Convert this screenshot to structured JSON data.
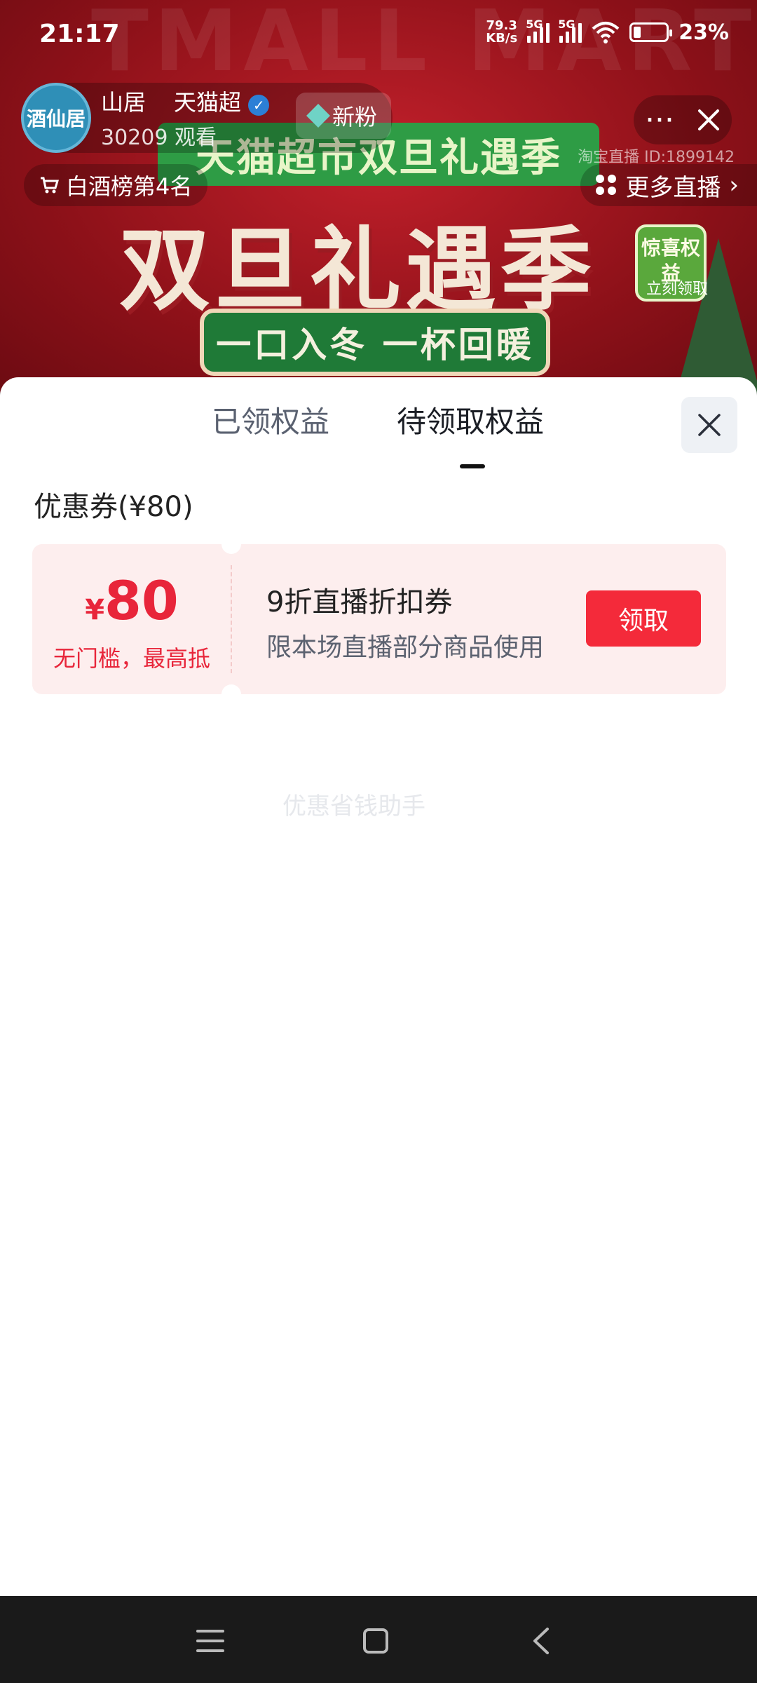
{
  "status_bar": {
    "time": "21:17",
    "net_speed_value": "79.3",
    "net_speed_unit": "KB/s",
    "signal1_label": "5G",
    "signal2_label": "5G",
    "battery_text": "23%",
    "battery_level": 0.23
  },
  "stream": {
    "watermark": "TMALL MART",
    "anchor_name": "山居",
    "anchor_brand": "天猫超",
    "avatar_text": "酒仙居",
    "viewers": "30209 观看",
    "follow_chip": "新粉",
    "stream_id": "淘宝直播 ID:1899142",
    "rank": "白酒榜第4名",
    "more_live": "更多直播",
    "banner_top": "天猫超市双旦礼遇季",
    "banner_title": "双旦礼遇季",
    "banner_slogan": "一口入冬 一杯回暖",
    "surprise_badge": "惊喜权益",
    "surprise_sub": "立刻领取"
  },
  "sheet": {
    "tabs": [
      {
        "label": "已领权益",
        "active": false
      },
      {
        "label": "待领取权益",
        "active": true
      }
    ],
    "section_title": "优惠券(¥80)",
    "coupon": {
      "currency": "¥",
      "amount": "80",
      "condition": "无门槛，最高抵",
      "name": "9折直播折扣券",
      "description": "限本场直播部分商品使用",
      "claim_label": "领取"
    },
    "watermark": "优惠省钱助手"
  },
  "colors": {
    "accent_red": "#f42a3a",
    "coupon_bg": "#fdeeee",
    "coupon_text": "#e8253a"
  },
  "icons": {
    "close": "close-icon",
    "more": "more-icon",
    "menu_nav": "menu-icon",
    "home_nav": "home-icon",
    "back_nav": "back-icon"
  }
}
